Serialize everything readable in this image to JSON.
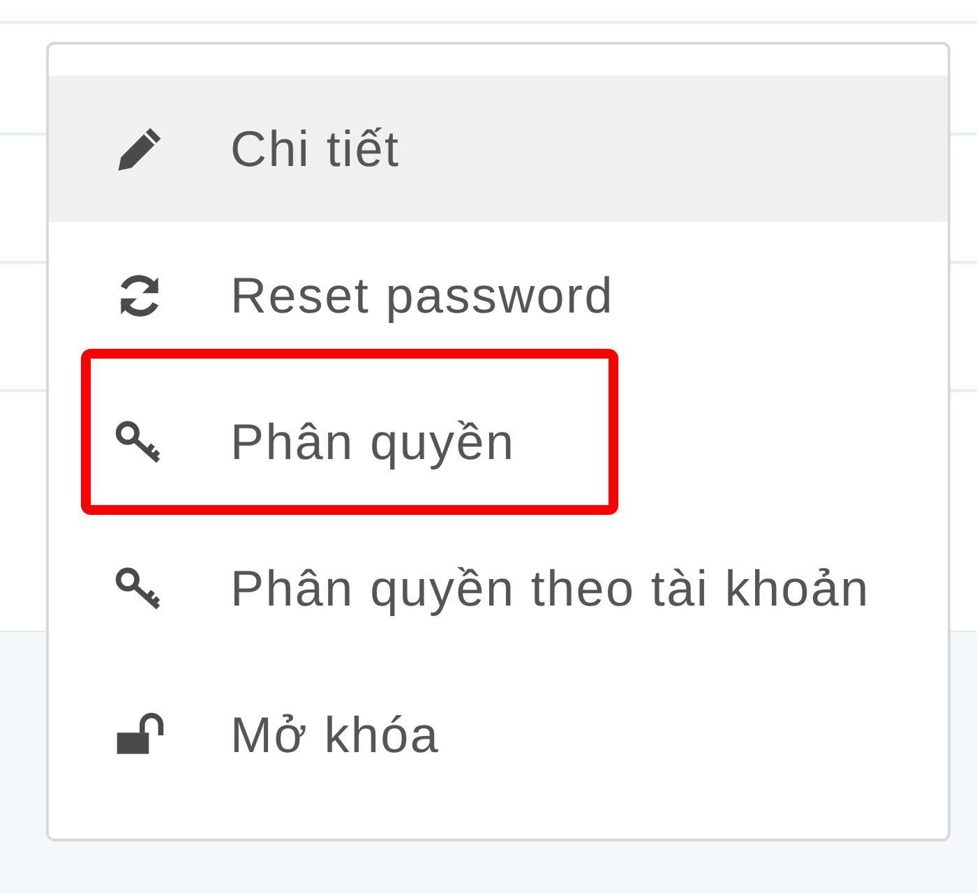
{
  "menu": {
    "items": [
      {
        "label": "Chi tiết",
        "kind": "pencil",
        "hovered": true,
        "annotated": false
      },
      {
        "label": "Reset password",
        "kind": "refresh",
        "hovered": false,
        "annotated": false
      },
      {
        "label": "Phân quyền",
        "kind": "key",
        "hovered": false,
        "annotated": true
      },
      {
        "label": "Phân quyền theo tài khoản",
        "kind": "key",
        "hovered": false,
        "annotated": false
      },
      {
        "label": "Mở khóa",
        "kind": "unlock",
        "hovered": false,
        "annotated": false
      }
    ]
  }
}
